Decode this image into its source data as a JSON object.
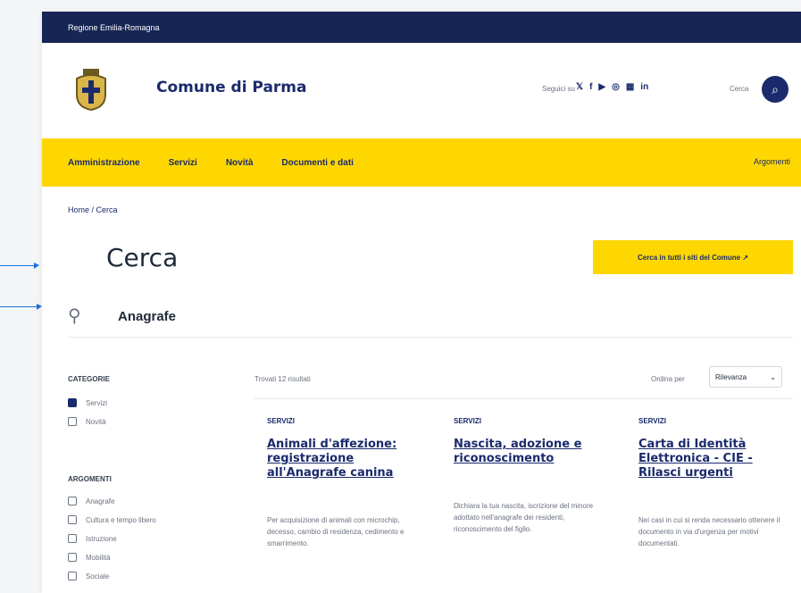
{
  "topbar": {
    "text": "Regione Emilia-Romagna"
  },
  "header": {
    "site_name": "Comune di Parma",
    "follow_label": "Seguici su",
    "social": [
      "𝕏",
      "f",
      "▶",
      "◎",
      "▦",
      "in"
    ],
    "search_label": "Cerca"
  },
  "nav": {
    "items": [
      "Amministrazione",
      "Servizi",
      "Novità",
      "Documenti e dati"
    ],
    "right": "Argomenti"
  },
  "breadcrumb": "Home / Cerca",
  "page_title": "Cerca",
  "cta_label": "Cerca in tutti i siti del Comune ↗",
  "search": {
    "query": "Anagrafe"
  },
  "filters": {
    "group1_title": "CATEGORIE",
    "group1_options": [
      {
        "label": "Servizi",
        "checked": true
      },
      {
        "label": "Novità",
        "checked": false
      }
    ],
    "group2_title": "ARGOMENTI",
    "group2_options": [
      {
        "label": "Anagrafe",
        "checked": false
      },
      {
        "label": "Cultura e tempo libero",
        "checked": false
      },
      {
        "label": "Istruzione",
        "checked": false
      },
      {
        "label": "Mobilità",
        "checked": false
      },
      {
        "label": "Sociale",
        "checked": false
      }
    ]
  },
  "results": {
    "count": "Trovati 12 risultati",
    "sort_label": "Ordina per",
    "sort_value": "Rilevanza",
    "cards": [
      {
        "category": "SERVIZI",
        "title": "Animali d'affezione: registrazione all'Anagrafe canina",
        "desc": "Per acquisizione di animali con microchip, decesso, cambio di residenza, cedimento e smarrimento."
      },
      {
        "category": "SERVIZI",
        "title": "Nascita, adozione e riconoscimento",
        "desc": "Dichiara la tua nascita, iscrizione del minore adottato nell'anagrafe dei residenti, riconoscimento del figlio."
      },
      {
        "category": "SERVIZI",
        "title": "Carta di Identità Elettronica - CIE - Rilasci urgenti",
        "desc": "Nei casi in cui si renda necessario ottenere il documento in via d'urgenza per motivi documentati."
      }
    ]
  },
  "colors": {
    "navy": "#172554",
    "brand": "#1a2a6c",
    "accent": "#ffd700"
  }
}
